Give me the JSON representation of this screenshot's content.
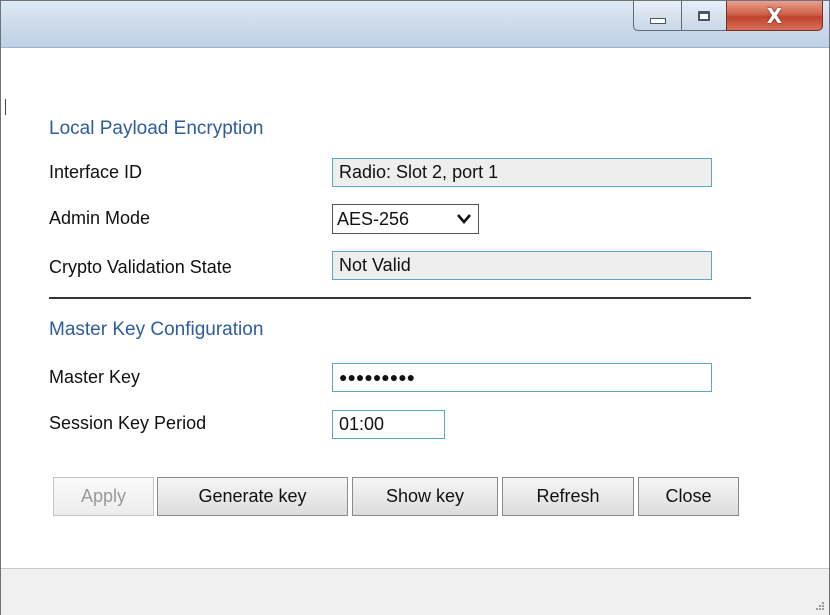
{
  "window": {
    "min_icon": "minimize-icon",
    "max_icon": "maximize-icon",
    "close_icon": "close-icon",
    "close_glyph": "X"
  },
  "encryption": {
    "title": "Local Payload Encryption",
    "interface_id_label": "Interface ID",
    "interface_id_value": "Radio: Slot 2, port 1",
    "admin_mode_label": "Admin Mode",
    "admin_mode_value": "AES-256",
    "crypto_state_label": "Crypto Validation State",
    "crypto_state_value": "Not Valid"
  },
  "master_key": {
    "title": "Master Key Configuration",
    "master_key_label": "Master Key",
    "master_key_value": "●●●●●●●●●",
    "session_period_label": "Session Key Period",
    "session_period_value": "01:00"
  },
  "buttons": {
    "apply": "Apply",
    "generate": "Generate key",
    "show": "Show key",
    "refresh": "Refresh",
    "close": "Close"
  },
  "colors": {
    "section_title": "#2f5c9c",
    "field_border": "#5aa7c4",
    "close_button": "#c2432c"
  }
}
